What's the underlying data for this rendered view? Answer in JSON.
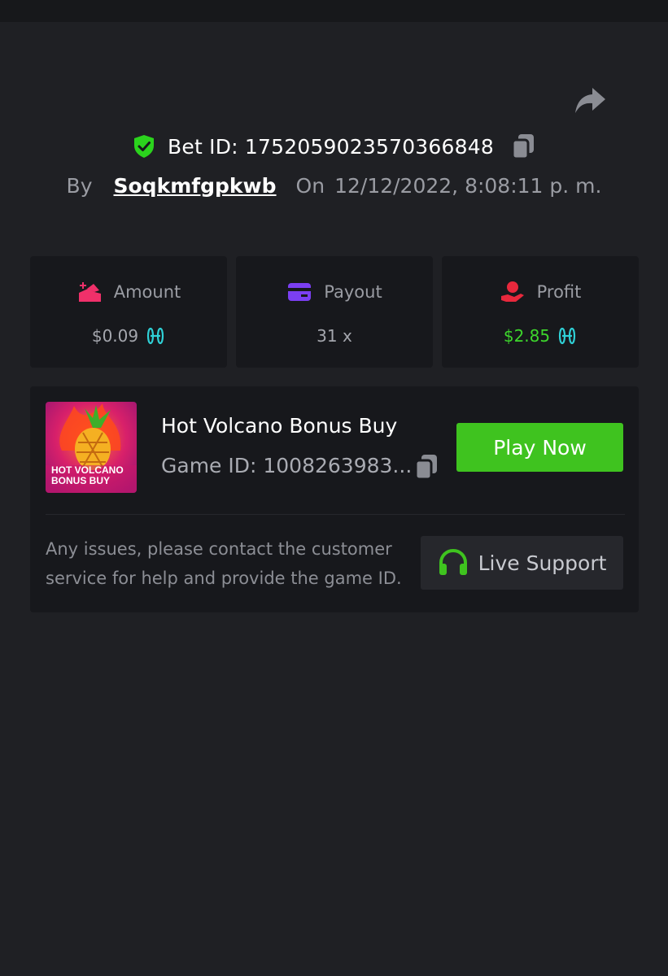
{
  "header": {
    "bet_id_label": "Bet ID: 1752059023570366848",
    "by_label": "By",
    "username": "Soqkmfgpkwb",
    "on_label": "On",
    "datetime": "12/12/2022, 8:08:11 p. m."
  },
  "stats": [
    {
      "title": "Amount",
      "value": "$0.09",
      "icon": "amount-icon",
      "color": "#f0306a"
    },
    {
      "title": "Payout",
      "value": "31 x",
      "icon": "card-icon",
      "color": "#7b3ff2"
    },
    {
      "title": "Profit",
      "value": "$2.85",
      "icon": "profit-hand-icon",
      "color": "#e8283c",
      "value_color": "#3dd62c"
    }
  ],
  "game": {
    "title": "Hot Volcano Bonus Buy",
    "game_id": "Game ID: 1008263983...",
    "thumb_text_line1": "HOT VOLCANO",
    "thumb_text_line2": "BONUS BUY",
    "play_label": "Play Now"
  },
  "support": {
    "note": "Any issues, please contact the customer service for help and provide the game ID.",
    "button_label": "Live Support"
  },
  "colors": {
    "background": "#1f2024",
    "card": "#17181c",
    "accent_green": "#3fc31f",
    "coin": "#2fd0d6"
  }
}
